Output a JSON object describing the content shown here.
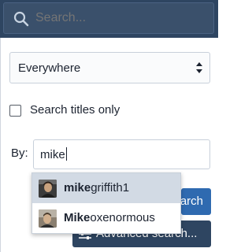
{
  "search_bar": {
    "placeholder": "Search...",
    "icon": "search-icon"
  },
  "constraints": {
    "scope_select_value": "Everywhere",
    "titles_only_label": "Search titles only",
    "titles_only_checked": false,
    "by_label": "By:",
    "by_value": "mike"
  },
  "buttons": {
    "search_label": "Search",
    "advanced_label": "Advanced search..."
  },
  "autocomplete": {
    "items": [
      {
        "match": "mike",
        "rest": "griffith1",
        "avatar": "user-avatar-photo"
      },
      {
        "match": "Mike",
        "rest": "oxenormous",
        "avatar": "user-avatar-photo"
      }
    ]
  },
  "colors": {
    "header_bg": "#2e4561",
    "primary_button": "#2f6ab0",
    "highlight_row": "#d2dae4"
  }
}
